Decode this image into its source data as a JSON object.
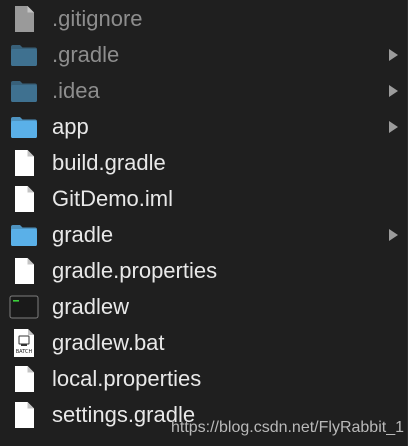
{
  "files": [
    {
      "name": ".gitignore",
      "kind": "document",
      "hidden": true,
      "has_children": false
    },
    {
      "name": ".gradle",
      "kind": "folder",
      "hidden": true,
      "has_children": true
    },
    {
      "name": ".idea",
      "kind": "folder",
      "hidden": true,
      "has_children": true
    },
    {
      "name": "app",
      "kind": "folder",
      "hidden": false,
      "has_children": true
    },
    {
      "name": "build.gradle",
      "kind": "document",
      "hidden": false,
      "has_children": false
    },
    {
      "name": "GitDemo.iml",
      "kind": "document",
      "hidden": false,
      "has_children": false
    },
    {
      "name": "gradle",
      "kind": "folder",
      "hidden": false,
      "has_children": true
    },
    {
      "name": "gradle.properties",
      "kind": "document",
      "hidden": false,
      "has_children": false
    },
    {
      "name": "gradlew",
      "kind": "terminal-executable",
      "hidden": false,
      "has_children": false
    },
    {
      "name": "gradlew.bat",
      "kind": "batch-file",
      "hidden": false,
      "has_children": false
    },
    {
      "name": "local.properties",
      "kind": "document",
      "hidden": false,
      "has_children": false
    },
    {
      "name": "settings.gradle",
      "kind": "document",
      "hidden": false,
      "has_children": false
    }
  ],
  "icons": {
    "folder": "folder-icon",
    "document": "document-icon",
    "terminal-executable": "terminal-icon",
    "batch-file": "batch-file-icon",
    "chevron": "chevron-right-icon"
  },
  "batch_icon_text": "BATCH",
  "watermark": "https://blog.csdn.net/FlyRabbit_1",
  "colors": {
    "background": "#1f1f1f",
    "text": "#e8e8e8",
    "hidden_text": "#8d8d8d",
    "folder": "#5ab0e8",
    "folder_hidden": "#3f7190",
    "document": "#ffffff",
    "document_hidden": "#9a9a9a",
    "chevron": "#9c9c9c"
  }
}
